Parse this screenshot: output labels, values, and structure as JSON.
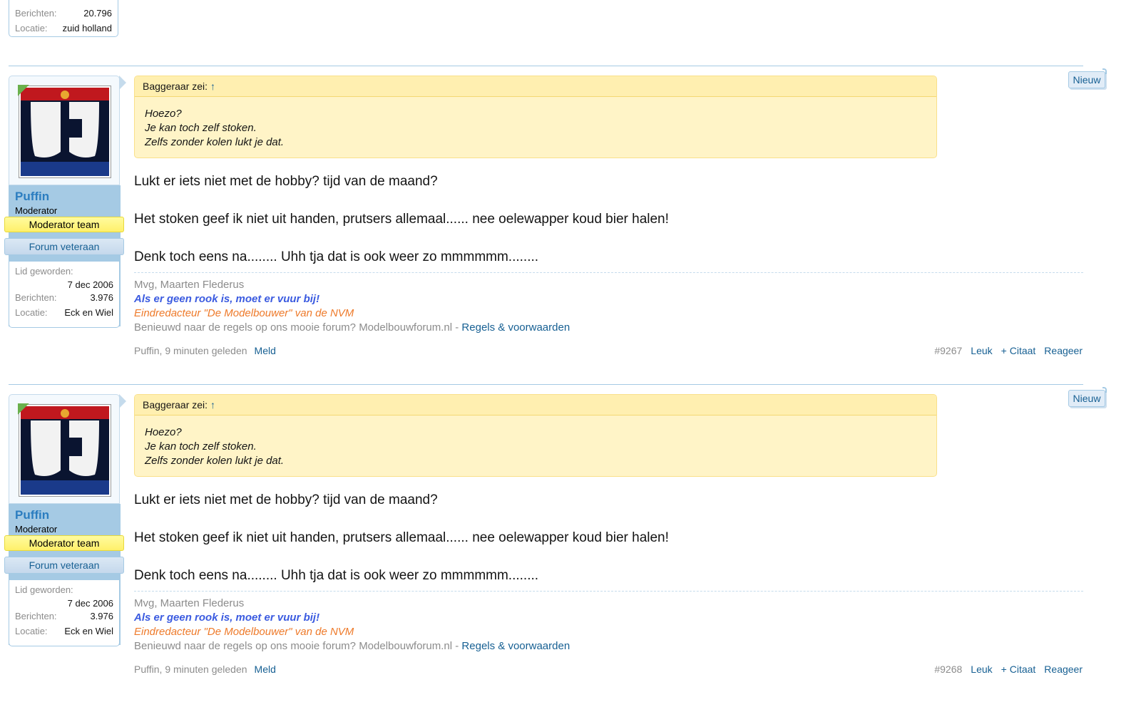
{
  "top_user": {
    "rows": [
      {
        "label": "Berichten:",
        "value": "20.796"
      },
      {
        "label": "Locatie:",
        "value": "zuid holland"
      }
    ]
  },
  "posts": [
    {
      "new_label": "Nieuw",
      "username": "Puffin",
      "user_title": "Moderator",
      "banner_mod": "Moderator team",
      "banner_vet": "Forum veteraan",
      "joined_label": "Lid geworden:",
      "joined_value": "7 dec 2006",
      "messages_label": "Berichten:",
      "messages_value": "3.976",
      "location_label": "Locatie:",
      "location_value": "Eck en Wiel",
      "quote_author": "Baggeraar zei:",
      "quote_arrow": "↑",
      "quote_lines": [
        "Hoezo?",
        "Je kan toch zelf stoken.",
        "Zelfs zonder kolen lukt je dat."
      ],
      "message_lines": [
        "Lukt er iets niet met de hobby? tijd van de maand?",
        "Het stoken geef ik niet uit handen, prutsers allemaal...... nee oelewapper koud bier halen!",
        "Denk toch eens na........ Uhh tja dat is ook weer zo mmmmmm........"
      ],
      "sig_name": "Mvg, Maarten Flederus",
      "sig_motto": "Als er geen rook is, moet er vuur bij!",
      "sig_role": "Eindredacteur \"De Modelbouwer\" van de NVM",
      "sig_rules_text": "Benieuwd naar de regels op ons mooie forum? Modelbouwforum.nl - ",
      "sig_rules_link": "Regels & voorwaarden",
      "meta_text": "Puffin, 9 minuten geleden",
      "report_label": "Meld",
      "post_number": "#9267",
      "like_label": "Leuk",
      "quote_label": "+ Citaat",
      "reply_label": "Reageer"
    },
    {
      "new_label": "Nieuw",
      "username": "Puffin",
      "user_title": "Moderator",
      "banner_mod": "Moderator team",
      "banner_vet": "Forum veteraan",
      "joined_label": "Lid geworden:",
      "joined_value": "7 dec 2006",
      "messages_label": "Berichten:",
      "messages_value": "3.976",
      "location_label": "Locatie:",
      "location_value": "Eck en Wiel",
      "quote_author": "Baggeraar zei:",
      "quote_arrow": "↑",
      "quote_lines": [
        "Hoezo?",
        "Je kan toch zelf stoken.",
        "Zelfs zonder kolen lukt je dat."
      ],
      "message_lines": [
        "Lukt er iets niet met de hobby? tijd van de maand?",
        "Het stoken geef ik niet uit handen, prutsers allemaal...... nee oelewapper koud bier halen!",
        "Denk toch eens na........ Uhh tja dat is ook weer zo mmmmmm........"
      ],
      "sig_name": "Mvg, Maarten Flederus",
      "sig_motto": "Als er geen rook is, moet er vuur bij!",
      "sig_role": "Eindredacteur \"De Modelbouwer\" van de NVM",
      "sig_rules_text": "Benieuwd naar de regels op ons mooie forum? Modelbouwforum.nl - ",
      "sig_rules_link": "Regels & voorwaarden",
      "meta_text": "Puffin, 9 minuten geleden",
      "report_label": "Meld",
      "post_number": "#9268",
      "like_label": "Leuk",
      "quote_label": "+ Citaat",
      "reply_label": "Reageer"
    }
  ]
}
